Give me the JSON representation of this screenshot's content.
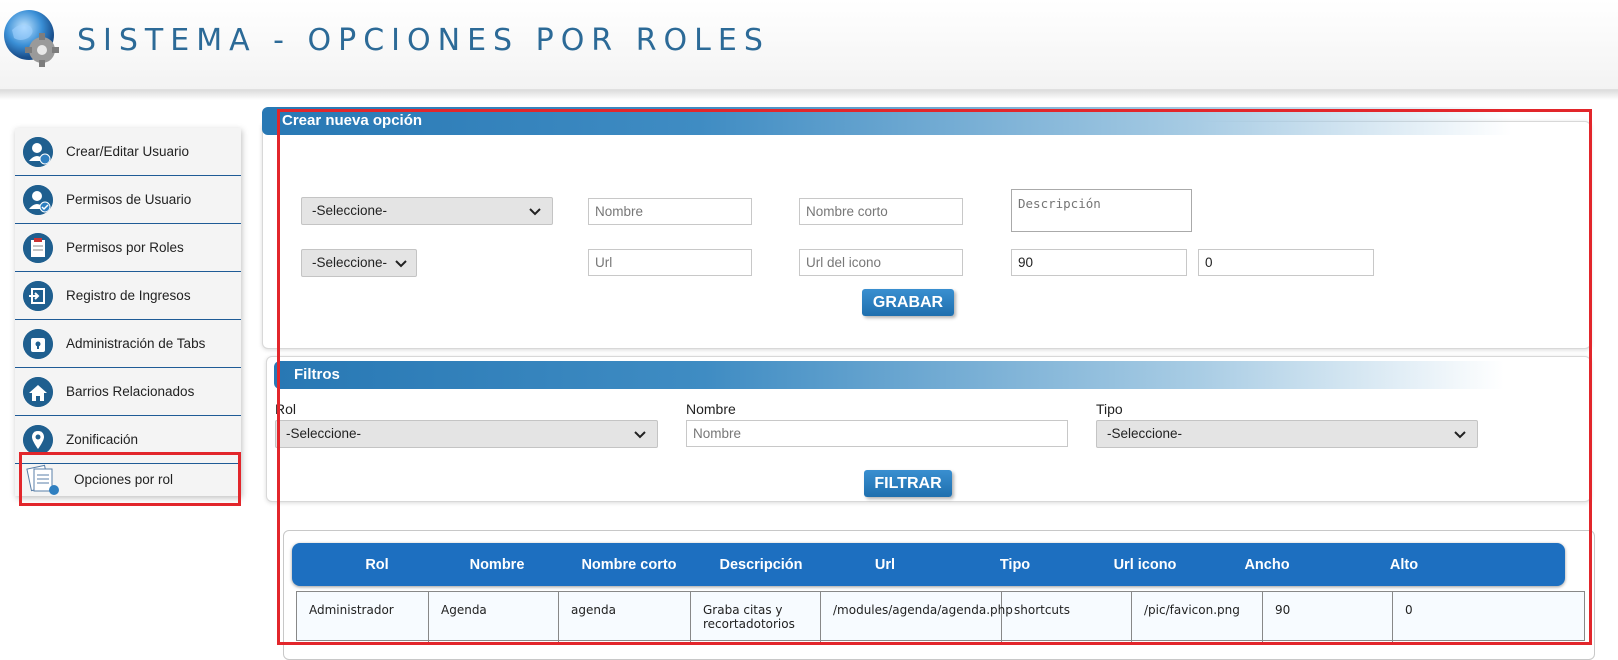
{
  "header": {
    "title": "SISTEMA - OPCIONES POR ROLES",
    "logo_icon": "globe-gear-icon"
  },
  "sidebar": {
    "items": [
      {
        "label": "Crear/Editar Usuario",
        "icon": "user-edit-icon"
      },
      {
        "label": "Permisos de Usuario",
        "icon": "user-check-icon"
      },
      {
        "label": "Permisos por Roles",
        "icon": "clipboard-icon"
      },
      {
        "label": "Registro de Ingresos",
        "icon": "login-icon"
      },
      {
        "label": "Administración de Tabs",
        "icon": "lock-icon"
      },
      {
        "label": "Barrios Relacionados",
        "icon": "home-icon"
      },
      {
        "label": "Zonificación",
        "icon": "map-pin-icon"
      },
      {
        "label": "Opciones por rol",
        "icon": "documents-icon"
      }
    ]
  },
  "create_panel": {
    "title": "Crear nueva opción",
    "select1": "-Seleccione-",
    "nombre_placeholder": "Nombre",
    "nombre_corto_placeholder": "Nombre corto",
    "descripcion_placeholder": "Descripción",
    "select2": "-Seleccione-",
    "url_placeholder": "Url",
    "url_icono_placeholder": "Url del icono",
    "ancho_value": "90",
    "alto_value": "0",
    "save_label": "GRABAR"
  },
  "filter_panel": {
    "title": "Filtros",
    "rol_label": "Rol",
    "rol_select": "-Seleccione-",
    "nombre_label": "Nombre",
    "nombre_placeholder": "Nombre",
    "tipo_label": "Tipo",
    "tipo_select": "-Seleccione-",
    "filter_label": "FILTRAR"
  },
  "table": {
    "columns": [
      "Rol",
      "Nombre",
      "Nombre corto",
      "Descripción",
      "Url",
      "Tipo",
      "Url icono",
      "Ancho",
      "Alto"
    ],
    "rows": [
      {
        "rol": "Administrador",
        "nombre": "Agenda",
        "nombre_corto": "agenda",
        "descripcion": "Graba citas y recortadotorios",
        "url": "/modules/agenda/agenda.php",
        "tipo": "shortcuts",
        "url_icono": "/pic/favicon.png",
        "ancho": "90",
        "alto": "0"
      }
    ]
  },
  "colors": {
    "accent": "#1d6fc0",
    "highlight": "#e2262b",
    "title": "#2c6a97"
  }
}
